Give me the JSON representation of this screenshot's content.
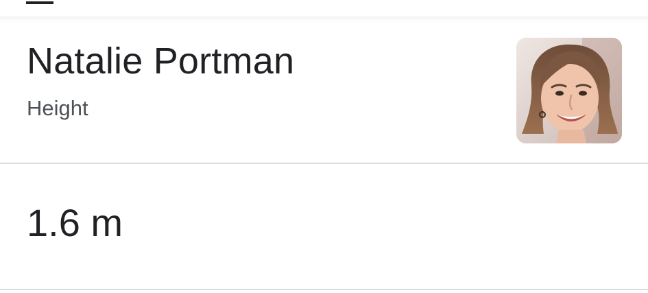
{
  "entity": {
    "name": "Natalie Portman",
    "attribute": "Height",
    "image_alt": "Natalie Portman"
  },
  "answer": {
    "value": "1.6 m"
  },
  "colors": {
    "title": "#202124",
    "subtitle": "#4d5156",
    "divider": "#dadce0"
  }
}
